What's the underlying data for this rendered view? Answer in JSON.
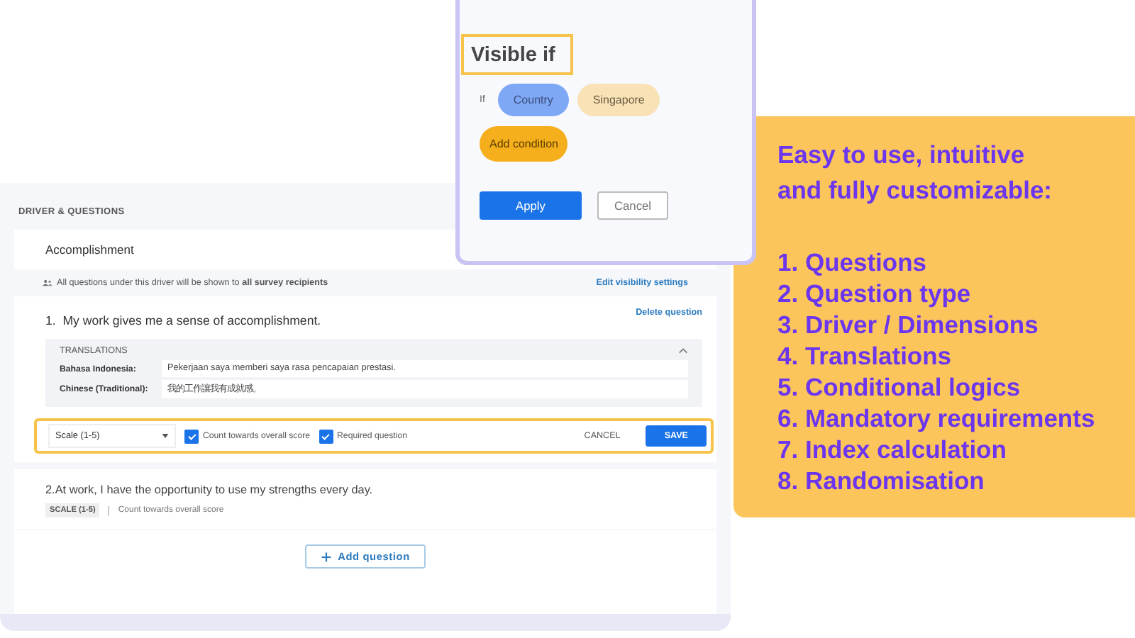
{
  "popup": {
    "title": "Visible if",
    "if_label": "If",
    "chips": [
      {
        "label": "Country",
        "kind": "field"
      },
      {
        "label": "Singapore",
        "kind": "value"
      }
    ],
    "add_button": "Add condition",
    "apply_button": "Apply",
    "cancel_button": "Cancel"
  },
  "panel": {
    "header": "DRIVER & QUESTIONS",
    "driver": "Accomplishment",
    "visibility": {
      "text": "All questions under this driver will be shown to **all survey recipients**",
      "link": "Edit visibility settings"
    },
    "question_1": {
      "number": "1.",
      "text": "My work gives me a sense of accomplishment.",
      "delete_link": "Delete question",
      "translations": {
        "title": "TRANSLATIONS",
        "expanded": true,
        "rows": [
          {
            "language": "Bahasa Indonesia:",
            "value": "Pekerjaan saya memberi saya rasa pencapaian prestasi."
          },
          {
            "language": "Chinese (Traditional):",
            "value": "我的工作讓我有成就感。"
          }
        ]
      },
      "toolbar": {
        "type_select": "Scale (1-5)",
        "checkboxes": [
          {
            "label": "Count towards overall score",
            "checked": true
          },
          {
            "label": "Required question",
            "checked": true
          }
        ],
        "cancel": "CANCEL",
        "save": "SAVE"
      }
    },
    "question_2": {
      "text": "2.At work, I have the opportunity to use my strengths every day.",
      "type_tag": "SCALE (1-5)",
      "note": "Count towards overall score"
    },
    "add_question": "Add question"
  },
  "card": {
    "heading_lines": [
      "Easy to use, intuitive",
      "and fully customizable:"
    ],
    "items": [
      "1. Questions",
      "2. Question type",
      "3. Driver / Dimensions",
      "4. Translations",
      "5. Conditional logics",
      "6. Mandatory requirements",
      "7. Index calculation",
      "8. Randomisation"
    ]
  }
}
